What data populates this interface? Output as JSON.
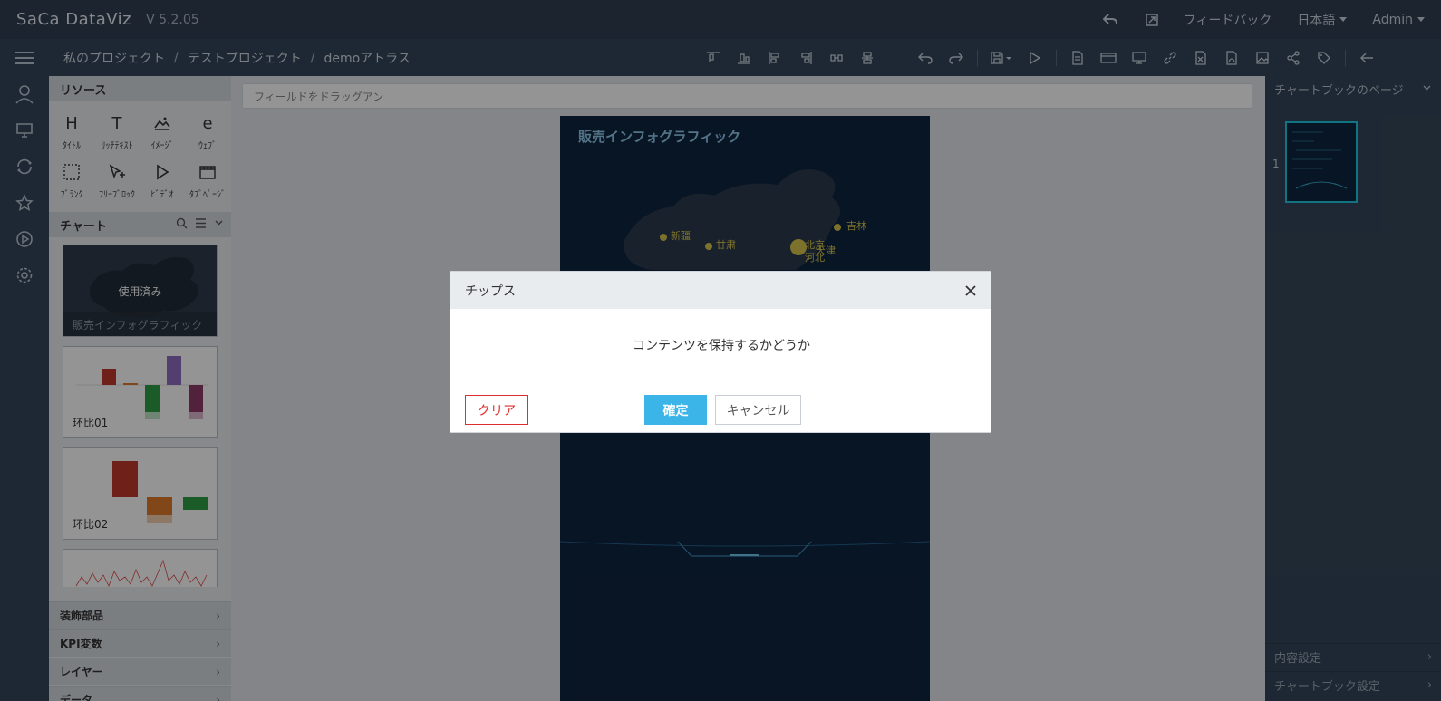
{
  "app": {
    "logo": "SaCa DataViz",
    "version": "V 5.2.05"
  },
  "top_right": {
    "feedback": "フィードバック",
    "language": "日本語",
    "user": "Admin"
  },
  "breadcrumb": [
    "私のプロジェクト",
    "テストプロジェクト",
    "demoアトラス"
  ],
  "breadcrumb_sep": "/",
  "resources": {
    "title": "リソース",
    "items": [
      {
        "glyph": "H",
        "label": "ﾀｲﾄﾙ",
        "icon": "title-icon"
      },
      {
        "glyph": "T",
        "label": "ﾘｯﾁﾃｷｽﾄ",
        "icon": "richtext-icon"
      },
      {
        "glyph": "",
        "label": "ｲﾒｰｼﾞ",
        "icon": "image-icon"
      },
      {
        "glyph": "e",
        "label": "ｳｪﾌﾞ",
        "icon": "web-icon"
      },
      {
        "glyph": "",
        "label": "ﾌﾞﾗﾝｸ",
        "icon": "blank-icon"
      },
      {
        "glyph": "",
        "label": "ﾌﾘｰﾌﾞﾛｯｸ",
        "icon": "freeblock-icon"
      },
      {
        "glyph": "",
        "label": "ﾋﾞﾃﾞｵ",
        "icon": "video-icon"
      },
      {
        "glyph": "",
        "label": "ﾀﾌﾞﾍﾟｰｼﾞ",
        "icon": "tabpage-icon"
      }
    ]
  },
  "charts": {
    "title": "チャート",
    "items": [
      {
        "name": "販売インフォグラフィック",
        "used_label": "使用済み"
      },
      {
        "name": "环比01"
      },
      {
        "name": "环比02"
      }
    ]
  },
  "collapse_sections": [
    "装飾部品",
    "KPI変数",
    "レイヤー",
    "データ"
  ],
  "canvas": {
    "drop_placeholder": "フィールドをドラッグアン",
    "page_title": "販売インフォグラフィック",
    "map_labels": [
      "新疆",
      "甘肃",
      "吉林",
      "北京",
      "天津",
      "河北"
    ]
  },
  "right_panel": {
    "title": "チャートブックのページ",
    "page_number": "1",
    "rows": [
      "内容設定",
      "チャートブック設定"
    ]
  },
  "modal": {
    "title": "チップス",
    "message": "コンテンツを保持するかどうか",
    "clear_label": "クリア",
    "ok_label": "確定",
    "cancel_label": "キャンセル"
  },
  "colors": {
    "accent": "#3bb4e8",
    "danger": "#e02d2d",
    "header": "#2f3f52"
  }
}
